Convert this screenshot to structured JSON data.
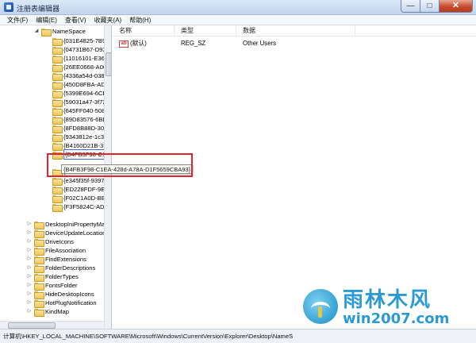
{
  "window": {
    "title": "注册表编辑器",
    "min_label": "—",
    "max_label": "□",
    "close_label": "✕"
  },
  "menu": [
    "文件(F)",
    "编辑(E)",
    "查看(V)",
    "收藏夹(A)",
    "帮助(H)"
  ],
  "tree": {
    "namespace_label": "NameSpace",
    "guid_children": [
      "{031E4825-7B94",
      "{04731B67-D933",
      "{11016101-E366",
      "{26EE0668-A00A",
      "{4336a54d-038b",
      "{450D8FBA-AD2",
      "{5399E694-6CE5",
      "{59031a47-3f72",
      "{645FF040-5081",
      "{89D83576-6BD",
      "{8FD8B88D-30E",
      "{9343812e-1c37",
      "{B4160D21B-3B2",
      "{B4FB3F98-C1EA",
      "{B4FB3F98-C1EA-428d-A78A-D1F5659CBA93}",
      "{daf95313-e44",
      "{e345f35f-9397-",
      "{ED228FDF-9EA",
      "{F02C1A0D-BE2",
      "{F3F5824C-AD5"
    ],
    "siblings": [
      "DesktopIniPropertyMa",
      "DeviceUpdateLocation",
      "DriveIcons",
      "FileAssociation",
      "FindExtensions",
      "FolderDescriptions",
      "FolderTypes",
      "FontsFolder",
      "HideDesktopIcons",
      "HotPlugNotification",
      "KindMap"
    ]
  },
  "tooltip_text": "{B4FB3F98-C1EA-428d-A78A-D1F5659CBA93}",
  "list": {
    "columns": [
      "名称",
      "类型",
      "数据"
    ],
    "rows": [
      {
        "name": "(默认)",
        "type": "REG_SZ",
        "data": "Other Users",
        "icon": "ab-icon"
      }
    ]
  },
  "statusbar": "计算机\\HKEY_LOCAL_MACHINE\\SOFTWARE\\Microsoft\\Windows\\CurrentVersion\\Explorer\\Desktop\\NameS",
  "watermark": {
    "title": "雨林木风",
    "url": "win2007.com"
  },
  "colors": {
    "highlight_border": "#e0262c",
    "watermark_blue": "#2b9ad2"
  }
}
